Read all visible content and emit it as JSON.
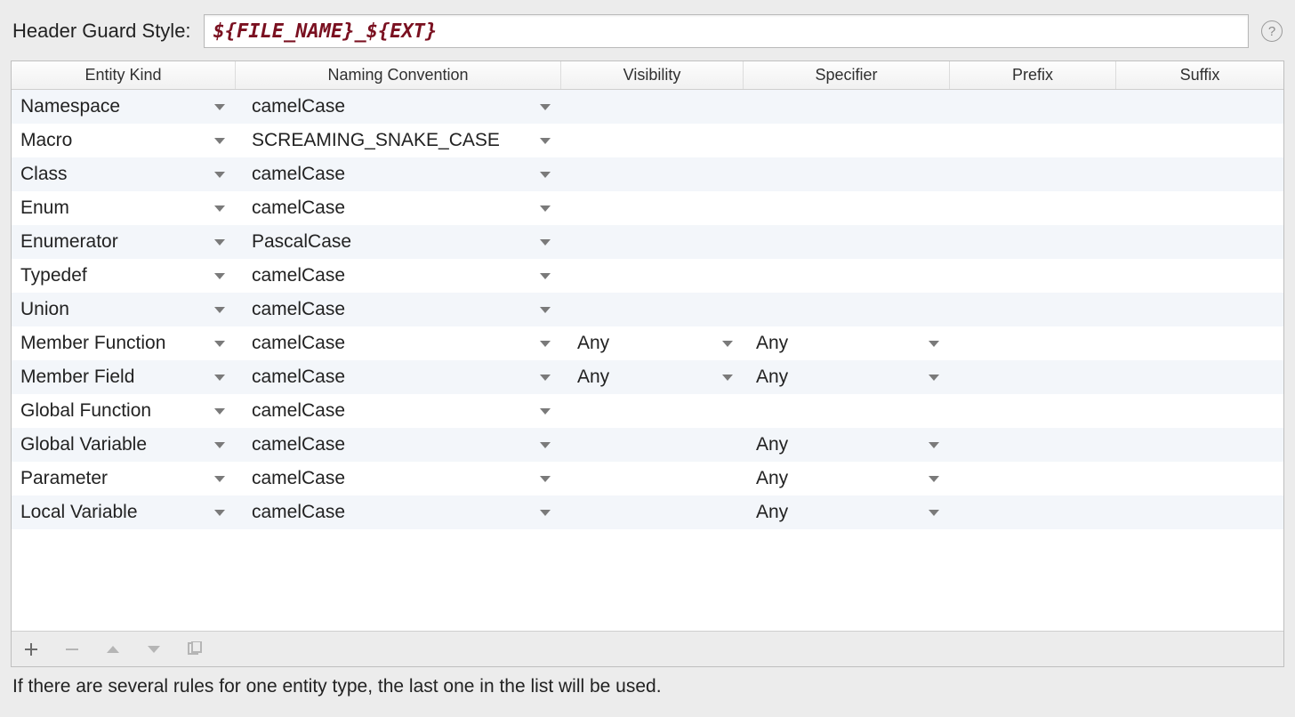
{
  "header": {
    "label": "Header Guard Style:",
    "value": "${FILE_NAME}_${EXT}",
    "help_tooltip": "?"
  },
  "columns": {
    "entity": "Entity Kind",
    "naming": "Naming Convention",
    "vis": "Visibility",
    "spec": "Specifier",
    "prefix": "Prefix",
    "suffix": "Suffix"
  },
  "rows": [
    {
      "entity": "Namespace",
      "naming": "camelCase",
      "vis": "",
      "spec": "",
      "hasVis": false,
      "hasSpec": false
    },
    {
      "entity": "Macro",
      "naming": "SCREAMING_SNAKE_CASE",
      "vis": "",
      "spec": "",
      "hasVis": false,
      "hasSpec": false
    },
    {
      "entity": "Class",
      "naming": "camelCase",
      "vis": "",
      "spec": "",
      "hasVis": false,
      "hasSpec": false
    },
    {
      "entity": "Enum",
      "naming": "camelCase",
      "vis": "",
      "spec": "",
      "hasVis": false,
      "hasSpec": false
    },
    {
      "entity": "Enumerator",
      "naming": "PascalCase",
      "vis": "",
      "spec": "",
      "hasVis": false,
      "hasSpec": false
    },
    {
      "entity": "Typedef",
      "naming": "camelCase",
      "vis": "",
      "spec": "",
      "hasVis": false,
      "hasSpec": false
    },
    {
      "entity": "Union",
      "naming": "camelCase",
      "vis": "",
      "spec": "",
      "hasVis": false,
      "hasSpec": false
    },
    {
      "entity": "Member Function",
      "naming": "camelCase",
      "vis": "Any",
      "spec": "Any",
      "hasVis": true,
      "hasSpec": true
    },
    {
      "entity": "Member Field",
      "naming": "camelCase",
      "vis": "Any",
      "spec": "Any",
      "hasVis": true,
      "hasSpec": true
    },
    {
      "entity": "Global Function",
      "naming": "camelCase",
      "vis": "",
      "spec": "",
      "hasVis": false,
      "hasSpec": false
    },
    {
      "entity": "Global Variable",
      "naming": "camelCase",
      "vis": "",
      "spec": "Any",
      "hasVis": false,
      "hasSpec": true
    },
    {
      "entity": "Parameter",
      "naming": "camelCase",
      "vis": "",
      "spec": "Any",
      "hasVis": false,
      "hasSpec": true
    },
    {
      "entity": "Local Variable",
      "naming": "camelCase",
      "vis": "",
      "spec": "Any",
      "hasVis": false,
      "hasSpec": true
    }
  ],
  "toolbar": {
    "add": "add-rule",
    "remove": "remove-rule",
    "up": "move-up",
    "down": "move-down",
    "copy": "duplicate-rule"
  },
  "footer": "If there are several rules for one entity type, the last one in the list will be used."
}
